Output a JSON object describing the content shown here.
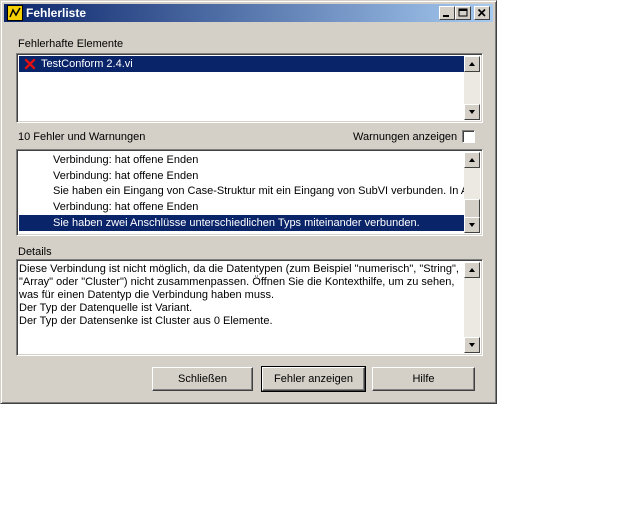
{
  "window": {
    "title": "Fehlerliste"
  },
  "elements_section": {
    "label": "Fehlerhafte Elemente",
    "items": [
      {
        "icon": "red-x-icon",
        "label": "TestConform 2.4.vi"
      }
    ]
  },
  "errors_section": {
    "count_label": "10 Fehler und Warnungen",
    "warnings_label": "Warnungen anzeigen",
    "warnings_checked": false,
    "items": [
      "Verbindung: hat offene Enden",
      "Verbindung: hat offene Enden",
      "Sie haben ein Eingang von Case-Struktur mit ein Eingang von SubVI verbunden. In Au",
      "Verbindung: hat offene Enden",
      "Sie haben zwei Anschlüsse unterschiedlichen Typs miteinander verbunden."
    ],
    "selected_index": 4
  },
  "details_section": {
    "label": "Details",
    "text": "Diese Verbindung ist nicht möglich, da die Datentypen (zum Beispiel \"numerisch\", \"String\",\n\"Array\" oder \"Cluster\") nicht zusammenpassen. Öffnen Sie die Kontexthilfe, um zu sehen,\nwas für einen Datentyp die Verbindung haben muss.\nDer Typ der Datenquelle ist Variant.\nDer Typ der Datensenke ist Cluster aus 0 Elemente."
  },
  "buttons": {
    "close": "Schließen",
    "show_error": "Fehler anzeigen",
    "help": "Hilfe"
  },
  "colors": {
    "titlebar_start": "#0a246a",
    "titlebar_end": "#a6caf0",
    "selection": "#0a246a",
    "face": "#d4d0c8"
  }
}
